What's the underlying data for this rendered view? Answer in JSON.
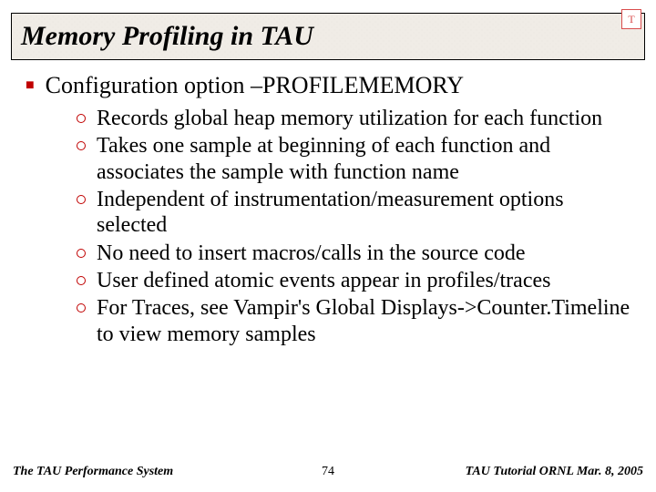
{
  "title": "Memory Profiling in TAU",
  "logo": "T",
  "heading": "Configuration option –PROFILEMEMORY",
  "items": [
    "Records global heap memory utilization for each function",
    "Takes one sample at beginning of each function and associates the sample with function name",
    "Independent of instrumentation/measurement options selected",
    "No need to insert macros/calls in the source code",
    "User defined atomic events appear in profiles/traces",
    "For Traces, see Vampir's Global Displays->Counter.Timeline to view memory samples"
  ],
  "footer": {
    "left": "The TAU Performance System",
    "center": "74",
    "right": "TAU Tutorial ORNL Mar. 8, 2005"
  }
}
